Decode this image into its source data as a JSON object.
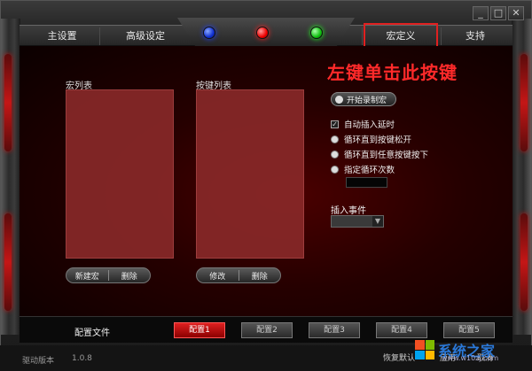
{
  "window": {
    "controls": [
      "_",
      "□",
      "✕"
    ]
  },
  "nav": {
    "main_settings": "主设置",
    "advanced_settings": "高级设定",
    "macro_definition": "宏定义",
    "support": "支持"
  },
  "annotation": "左键单击此按键",
  "macro_list": {
    "label": "宏列表",
    "new_button": "新建宏",
    "delete_button": "删除"
  },
  "key_list": {
    "label": "按键列表",
    "edit_button": "修改",
    "delete_button": "删除"
  },
  "record_button": "开始录制宏",
  "options": {
    "auto_insert_delay": {
      "label": "自动插入延时",
      "checked": true
    },
    "loop_until_release": {
      "label": "循环直到按键松开"
    },
    "loop_until_any_key": {
      "label": "循环直到任意按键按下"
    },
    "loop_count": {
      "label": "指定循环次数"
    }
  },
  "insert_event": {
    "label": "插入事件",
    "value": ""
  },
  "config": {
    "file_label": "配置文件",
    "tabs": [
      "配置1",
      "配置2",
      "配置3",
      "配置4",
      "配置5"
    ],
    "active_index": 0
  },
  "footer": {
    "version_label": "驱动版本",
    "version_value": "1.0.8",
    "restore_default": "恢复默认",
    "apply": "应用",
    "cancel": "取消"
  },
  "watermark": {
    "text": "系统之家",
    "url": "www.w10zj.com"
  },
  "colors": {
    "accent_red": "#e02020",
    "annotation_red": "#ff2a2a",
    "led_blue": "#1030d0",
    "led_red": "#ee0000",
    "led_green": "#10c010"
  }
}
